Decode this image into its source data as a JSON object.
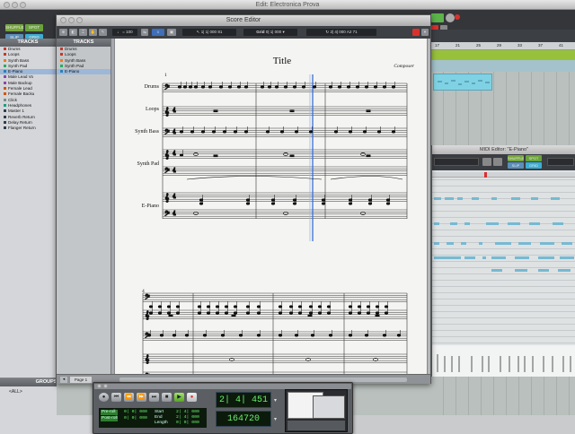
{
  "edit_window": {
    "title": "Edit: Electronica Prova",
    "modes": [
      "SHUFFLE",
      "SPOT",
      "SLIP",
      "GRID"
    ],
    "ruler_numbers": [
      "17",
      "21",
      "25",
      "29",
      "33",
      "37",
      "41"
    ],
    "tracks_header": "TRACKS",
    "tracks": [
      {
        "name": "Drums",
        "color": "#c0392b"
      },
      {
        "name": "Loops",
        "color": "#c0392b"
      },
      {
        "name": "Synth Bass",
        "color": "#e67e22"
      },
      {
        "name": "Synth Pad",
        "color": "#27ae60"
      },
      {
        "name": "E-Piano",
        "color": "#2980b9"
      },
      {
        "name": "Male Lead Vo",
        "color": "#8e44ad"
      },
      {
        "name": "Male Backup",
        "color": "#8e44ad"
      },
      {
        "name": "Female Lead",
        "color": "#d35400"
      },
      {
        "name": "Female Backu",
        "color": "#d35400"
      },
      {
        "name": "Click",
        "color": "#7f8c8d"
      },
      {
        "name": "Headphones",
        "color": "#16a085"
      },
      {
        "name": "Master 1",
        "color": "#2c3e50"
      },
      {
        "name": "Reverb Return",
        "color": "#2c3e50"
      },
      {
        "name": "Delay Return",
        "color": "#2c3e50"
      },
      {
        "name": "Flanger Return",
        "color": "#2c3e50"
      }
    ],
    "groups_header": "GROUPS",
    "groups": [
      "<ALL>"
    ]
  },
  "score_editor": {
    "title": "Score Editor",
    "toolbar": {
      "tempo": "= 100",
      "position": "1| 1| 000",
      "bars": "81",
      "grid_label": "Grid",
      "grid_value": "0| 1| 000",
      "nudge": "2| 4| 000",
      "nudge_note": "A2",
      "track": "71"
    },
    "tracks_header": "TRACKS",
    "tracks": [
      "Drums",
      "Loops",
      "Synth Bass",
      "Synth Pad",
      "E-Piano"
    ],
    "page": {
      "title": "Title",
      "composer": "Composer",
      "system1_number": "1",
      "system2_number": "4",
      "instrument_labels": [
        "Drums",
        "Loops",
        "Synth Bass",
        "Synth Pad",
        "E-Piano"
      ]
    },
    "page_tab": "Page 1"
  },
  "midi_editor": {
    "title": "MIDI Editor: \"E-Piano\"",
    "modes": [
      "SHUFFLE",
      "SPOT",
      "SLIP",
      "GRID"
    ]
  },
  "transport": {
    "counter_main": "2| 4| 451",
    "counter_sub": "164720",
    "pre_roll_label": "Pre-roll",
    "post_roll_label": "Post-roll",
    "pre_roll_value": "0| 0| 000",
    "post_roll_value": "0| 0| 000",
    "start_label": "Start",
    "end_label": "End",
    "length_label": "Length",
    "start_value": "2| 4| 000",
    "end_value": "2| 4| 000",
    "length_value": "0| 0| 000"
  },
  "colors": {
    "note_blue": "#77b9d2",
    "clip_cyan": "#7fd2e3",
    "lcd_green": "#68f06a",
    "record_red": "#d8312d",
    "selected_track": "#9db7d8"
  }
}
